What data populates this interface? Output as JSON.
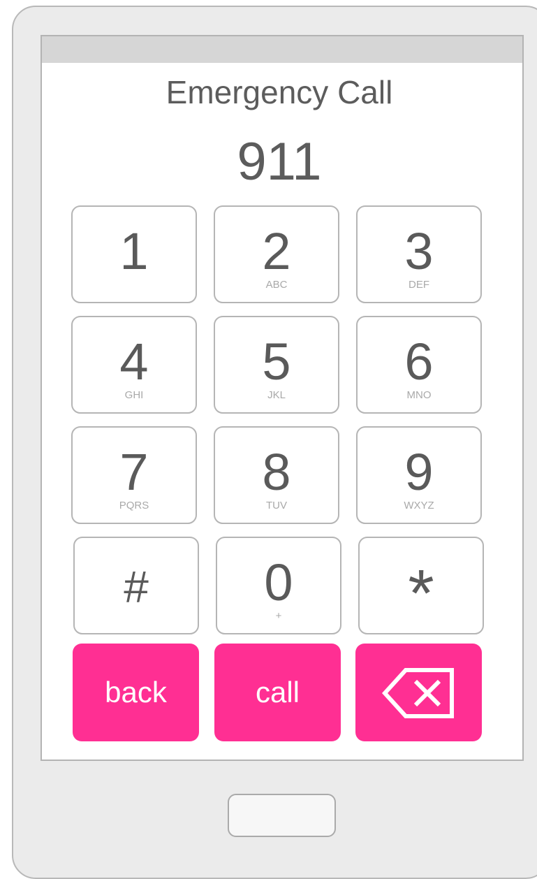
{
  "screen": {
    "title": "Emergency Call",
    "dialed_number": "911"
  },
  "keypad": {
    "keys": [
      {
        "digit": "1",
        "letters": ""
      },
      {
        "digit": "2",
        "letters": "ABC"
      },
      {
        "digit": "3",
        "letters": "DEF"
      },
      {
        "digit": "4",
        "letters": "GHI"
      },
      {
        "digit": "5",
        "letters": "JKL"
      },
      {
        "digit": "6",
        "letters": "MNO"
      },
      {
        "digit": "7",
        "letters": "PQRS"
      },
      {
        "digit": "8",
        "letters": "TUV"
      },
      {
        "digit": "9",
        "letters": "WXYZ"
      },
      {
        "digit": "#",
        "letters": ""
      },
      {
        "digit": "0",
        "letters": "+"
      },
      {
        "digit": "*",
        "letters": ""
      }
    ]
  },
  "actions": {
    "back_label": "back",
    "call_label": "call",
    "delete_icon": "backspace-icon",
    "accent_color": "#ff2f93"
  },
  "device": {
    "home_button_icon": "home-button"
  }
}
